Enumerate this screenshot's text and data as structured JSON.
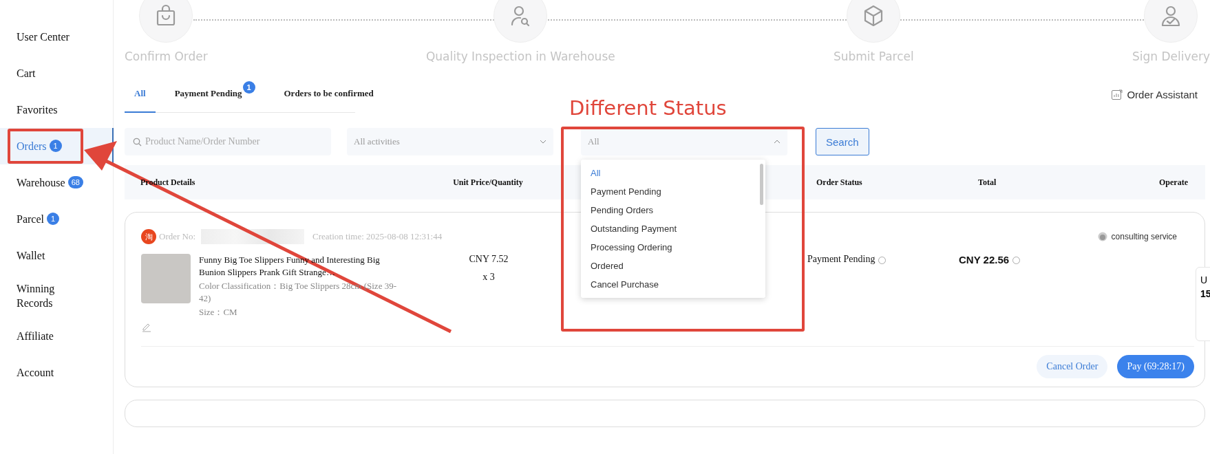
{
  "sidebar": {
    "items": [
      {
        "label": "User Center",
        "selected": false
      },
      {
        "label": "Cart",
        "selected": false
      },
      {
        "label": "Favorites",
        "selected": false
      },
      {
        "label": "Orders",
        "selected": true,
        "badge": "1"
      },
      {
        "label": "Warehouse",
        "selected": false,
        "badge": "68"
      },
      {
        "label": "Parcel",
        "selected": false,
        "badge": "1"
      },
      {
        "label": "Wallet",
        "selected": false
      },
      {
        "label": "Winning Records",
        "selected": false
      },
      {
        "label": "Affiliate",
        "selected": false
      },
      {
        "label": "Account",
        "selected": false
      }
    ]
  },
  "steps": [
    {
      "label": "Confirm Order",
      "kind": "bag"
    },
    {
      "label": "Quality Inspection in Warehouse",
      "kind": "inspect"
    },
    {
      "label": "Submit Parcel",
      "kind": "box"
    },
    {
      "label": "Sign Delivery",
      "kind": "delivery"
    }
  ],
  "tabs": [
    {
      "label": "All",
      "selected": true
    },
    {
      "label": "Payment Pending",
      "selected": false,
      "badge": "1"
    },
    {
      "label": "Orders to be confirmed",
      "selected": false
    }
  ],
  "order_assistant": "Order Assistant",
  "filters": {
    "search": {
      "placeholder": "Product Name/Order Number"
    },
    "activity": {
      "placeholder": "All activities"
    },
    "status": {
      "value": "All",
      "expanded": true,
      "options": [
        {
          "label": "All",
          "selected": true
        },
        {
          "label": "Payment Pending",
          "selected": false
        },
        {
          "label": "Pending Orders",
          "selected": false
        },
        {
          "label": "Outstanding Payment",
          "selected": false
        },
        {
          "label": "Processing Ordering",
          "selected": false
        },
        {
          "label": "Ordered",
          "selected": false
        },
        {
          "label": "Cancel Purchase",
          "selected": false
        }
      ]
    },
    "search_button": "Search"
  },
  "table": {
    "columns": [
      "Product Details",
      "Unit Price/Quantity",
      "Order Status",
      "Total",
      "Operate"
    ]
  },
  "order": {
    "shop_badge": "淘",
    "order_no_label": "Order No:",
    "creation_time": "Creation time: 2025-08-08 12:31:44",
    "consulting": "consulting service",
    "title": "Funny Big Toe Slippers Funny and Interesting Big Bunion Slippers Prank Gift Strange…",
    "spec": "Color Classification：Big Toe Slippers 28cm (Size 39-42)",
    "size": "Size：CM",
    "price": "CNY 7.52",
    "quantity": "x 3",
    "status": "Payment Pending",
    "total": "CNY 22.56",
    "buttons": [
      {
        "label": "Cancel Order",
        "kind": "secondary"
      },
      {
        "label": "Pay (69:28:17)",
        "kind": "primary"
      }
    ]
  },
  "side_panel": {
    "line_1": "U",
    "line_2": "15"
  },
  "annotation": {
    "label": "Different Status"
  }
}
